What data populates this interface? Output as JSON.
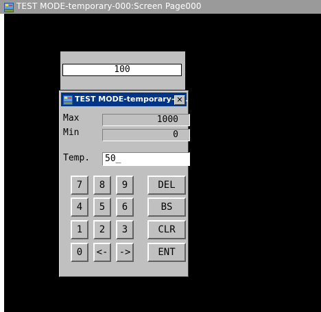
{
  "window": {
    "title": "TEST MODE-temporary-000:Screen Page000",
    "icon": "hmi-app-icon"
  },
  "screen": {
    "display_value": "100"
  },
  "popup": {
    "title": "TEST MODE-temporary-0...",
    "close_label": "✕",
    "max_label": "Max",
    "max_value": "1000",
    "min_label": "Min",
    "min_value": "0",
    "temp_label": "Temp.",
    "temp_value": "50_"
  },
  "keypad": {
    "digits": [
      "7",
      "8",
      "9",
      "4",
      "5",
      "6",
      "1",
      "2",
      "3",
      "0",
      "<-",
      "->"
    ],
    "functions": [
      "DEL",
      "BS",
      "CLR",
      "ENT"
    ]
  },
  "colors": {
    "screen_bg": "#000000",
    "panel_bg": "#c0c0c0",
    "active_title": "#003487",
    "inactive_title": "#9a9a9a"
  }
}
